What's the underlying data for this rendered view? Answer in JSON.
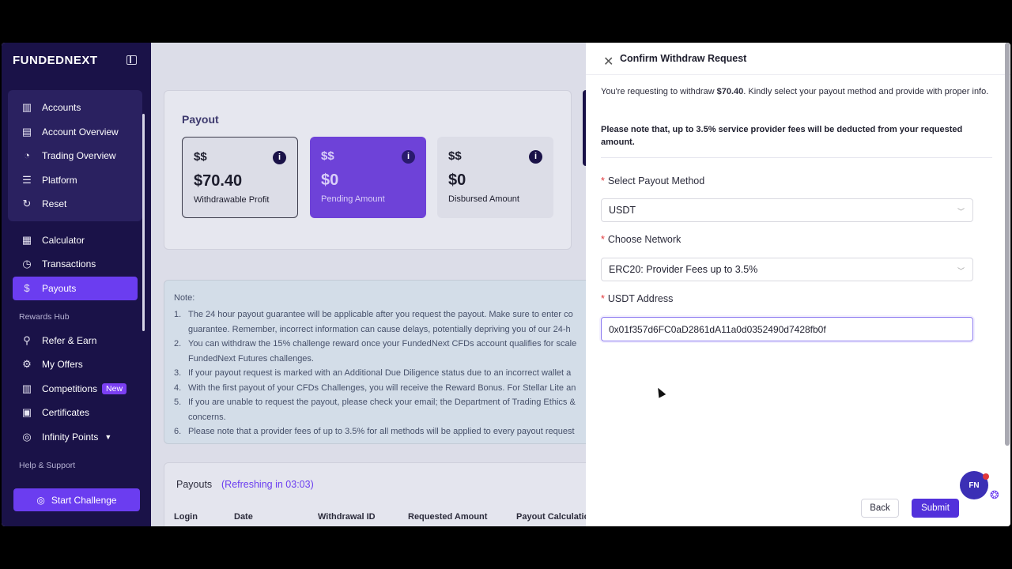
{
  "sidebar": {
    "logo": "FUNDEDNEXT",
    "group_items": [
      {
        "label": "Accounts",
        "icon": "bar-chart-icon"
      },
      {
        "label": "Account Overview",
        "icon": "analytics-icon"
      },
      {
        "label": "Trading Overview",
        "icon": "pie-chart-icon"
      },
      {
        "label": "Platform",
        "icon": "database-icon"
      },
      {
        "label": "Reset",
        "icon": "refresh-icon"
      }
    ],
    "items": [
      {
        "label": "Calculator",
        "icon": "calculator-icon"
      },
      {
        "label": "Transactions",
        "icon": "history-icon"
      },
      {
        "label": "Payouts",
        "icon": "dollar-icon"
      }
    ],
    "rewards_hub_label": "Rewards Hub",
    "rewards_items": [
      {
        "label": "Refer & Earn",
        "icon": "user-add-icon"
      },
      {
        "label": "My Offers",
        "icon": "gear-icon"
      },
      {
        "label": "Competitions",
        "icon": "bar-chart-icon",
        "badge": "New"
      },
      {
        "label": "Certificates",
        "icon": "certificate-icon"
      },
      {
        "label": "Infinity Points",
        "icon": "coins-icon"
      }
    ],
    "help_label": "Help & Support",
    "start_challenge": "Start Challenge"
  },
  "payout": {
    "title": "Payout",
    "stats": [
      {
        "amount": "$70.40",
        "label": "Withdrawable Profit"
      },
      {
        "amount": "$0",
        "label": "Pending Amount"
      },
      {
        "amount": "$0",
        "label": "Disbursed Amount"
      }
    ]
  },
  "note": {
    "title": "Note:",
    "items": [
      {
        "n": "1.",
        "text": "The 24 hour payout guarantee will be applicable after you request the payout. Make sure to enter co"
      },
      {
        "n": "",
        "text": "guarantee. Remember, incorrect information can cause delays, potentially depriving you of our 24-h"
      },
      {
        "n": "2.",
        "text": "You can withdraw the 15% challenge reward once your FundedNext CFDs account qualifies for scale"
      },
      {
        "n": "",
        "text": "FundedNext Futures challenges."
      },
      {
        "n": "3.",
        "text": "If your payout request is marked with an Additional Due Diligence status due to an incorrect wallet a"
      },
      {
        "n": "4.",
        "text": "With the first payout of your CFDs Challenges, you will receive the Reward Bonus. For Stellar Lite an"
      },
      {
        "n": "5.",
        "text": "If you are unable to request the payout, please check your email; the Department of Trading Ethics &"
      },
      {
        "n": "",
        "text": "concerns."
      },
      {
        "n": "6.",
        "text": "Please note that a provider fees of up to 3.5% for all methods will be applied to every payout request"
      }
    ]
  },
  "payouts_table": {
    "title": "Payouts",
    "refresh": "(Refreshing in 03:03)",
    "headers": [
      "Login",
      "Date",
      "Withdrawal ID",
      "Requested Amount",
      "Payout Calculatio"
    ]
  },
  "drawer": {
    "title": "Confirm Withdraw Request",
    "intro_prefix": "You're requesting to withdraw ",
    "intro_amount": "$70.40",
    "intro_suffix": ". Kindly select your payout method and provide with proper info.",
    "warning": "Please note that, up to 3.5% service provider fees will be deducted from your requested amount.",
    "payout_method_label": "Select Payout Method",
    "payout_method_value": "USDT",
    "network_label": "Choose Network",
    "network_value": "ERC20: Provider Fees up to 3.5%",
    "address_label": "USDT Address",
    "address_value": "0x01f357d6FC0aD2861dA11a0d0352490d7428fb0f",
    "back": "Back",
    "submit": "Submit",
    "chat": "FN"
  },
  "colors": {
    "accent": "#6b3df0",
    "sidebar": "#1a1248",
    "required": "#e0383b"
  }
}
